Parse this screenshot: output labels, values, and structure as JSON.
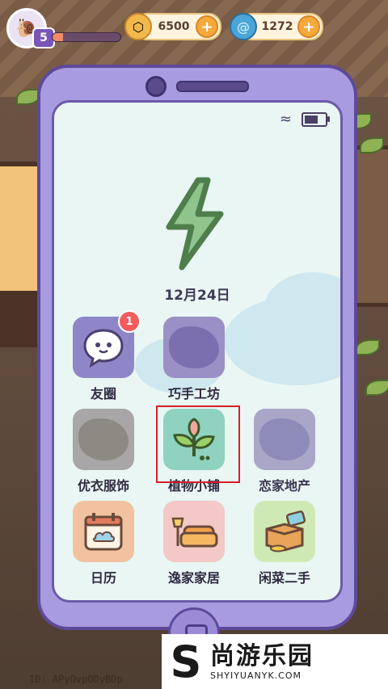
{
  "status_bar": {
    "level": "5",
    "xp_progress": 0.15,
    "coins": "6500",
    "gems": "1272"
  },
  "phone": {
    "date": "12月24日",
    "apps": [
      {
        "label": "友圈",
        "badge": "1",
        "icon": "chat-bubble-icon",
        "color": "#8f86c8"
      },
      {
        "label": "巧手工坊",
        "icon": "workshop-silhouette-icon",
        "color": "#9b90c6"
      },
      {
        "label": "优衣服饰",
        "icon": "clothing-silhouette-icon",
        "color": "#a8a6a6"
      },
      {
        "label": "植物小铺",
        "icon": "sprout-icon",
        "color": "#8fd2c0"
      },
      {
        "label": "恋家地产",
        "icon": "house-silhouette-icon",
        "color": "#a9a6c8"
      },
      {
        "label": "日历",
        "icon": "calendar-icon",
        "color": "#f2c2a0"
      },
      {
        "label": "逸家家居",
        "icon": "sofa-lamp-icon",
        "color": "#f3c8c6"
      },
      {
        "label": "闲菜二手",
        "icon": "box-tag-icon",
        "color": "#cfe9b4"
      }
    ]
  },
  "footer": {
    "player_id": "ID: APyOvpODyBDp"
  },
  "watermark": {
    "logo": "S",
    "name": "尚游乐园",
    "url": "SHYIYUANYK.COM"
  },
  "colors": {
    "highlight": "#d61f2a",
    "phone_body": "#a99be0",
    "screen": "#e9f6f3"
  }
}
